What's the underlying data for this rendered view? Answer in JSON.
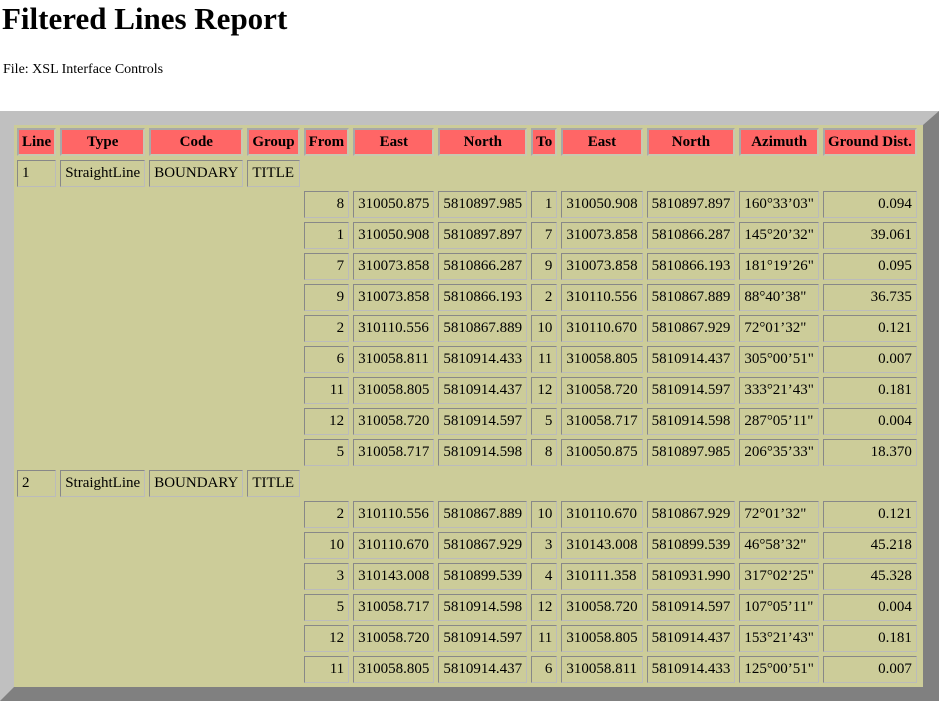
{
  "title": "Filtered Lines Report",
  "file": "File: XSL Interface Controls",
  "headers": [
    "Line",
    "Type",
    "Code",
    "Group",
    "From",
    "East",
    "North",
    "To",
    "East",
    "North",
    "Azimuth",
    "Ground Dist."
  ],
  "colors": {
    "header": "#ff6666",
    "table": "#cccc99",
    "border_light": "#c0c0c0",
    "border_dark": "#808080"
  },
  "lines": [
    {
      "line": "1",
      "type": "StraightLine",
      "code": "BOUNDARY",
      "group": "TITLE",
      "segments": [
        [
          "8",
          "310050.875",
          "5810897.985",
          "1",
          "310050.908",
          "5810897.897",
          "160°33’03\"",
          "0.094"
        ],
        [
          "1",
          "310050.908",
          "5810897.897",
          "7",
          "310073.858",
          "5810866.287",
          "145°20’32\"",
          "39.061"
        ],
        [
          "7",
          "310073.858",
          "5810866.287",
          "9",
          "310073.858",
          "5810866.193",
          "181°19’26\"",
          "0.095"
        ],
        [
          "9",
          "310073.858",
          "5810866.193",
          "2",
          "310110.556",
          "5810867.889",
          "88°40’38\"",
          "36.735"
        ],
        [
          "2",
          "310110.556",
          "5810867.889",
          "10",
          "310110.670",
          "5810867.929",
          "72°01’32\"",
          "0.121"
        ],
        [
          "6",
          "310058.811",
          "5810914.433",
          "11",
          "310058.805",
          "5810914.437",
          "305°00’51\"",
          "0.007"
        ],
        [
          "11",
          "310058.805",
          "5810914.437",
          "12",
          "310058.720",
          "5810914.597",
          "333°21’43\"",
          "0.181"
        ],
        [
          "12",
          "310058.720",
          "5810914.597",
          "5",
          "310058.717",
          "5810914.598",
          "287°05’11\"",
          "0.004"
        ],
        [
          "5",
          "310058.717",
          "5810914.598",
          "8",
          "310050.875",
          "5810897.985",
          "206°35’33\"",
          "18.370"
        ]
      ]
    },
    {
      "line": "2",
      "type": "StraightLine",
      "code": "BOUNDARY",
      "group": "TITLE",
      "segments": [
        [
          "2",
          "310110.556",
          "5810867.889",
          "10",
          "310110.670",
          "5810867.929",
          "72°01’32\"",
          "0.121"
        ],
        [
          "10",
          "310110.670",
          "5810867.929",
          "3",
          "310143.008",
          "5810899.539",
          "46°58’32\"",
          "45.218"
        ],
        [
          "3",
          "310143.008",
          "5810899.539",
          "4",
          "310111.358",
          "5810931.990",
          "317°02’25\"",
          "45.328"
        ],
        [
          "5",
          "310058.717",
          "5810914.598",
          "12",
          "310058.720",
          "5810914.597",
          "107°05’11\"",
          "0.004"
        ],
        [
          "12",
          "310058.720",
          "5810914.597",
          "11",
          "310058.805",
          "5810914.437",
          "153°21’43\"",
          "0.181"
        ],
        [
          "11",
          "310058.805",
          "5810914.437",
          "6",
          "310058.811",
          "5810914.433",
          "125°00’51\"",
          "0.007"
        ]
      ]
    }
  ]
}
